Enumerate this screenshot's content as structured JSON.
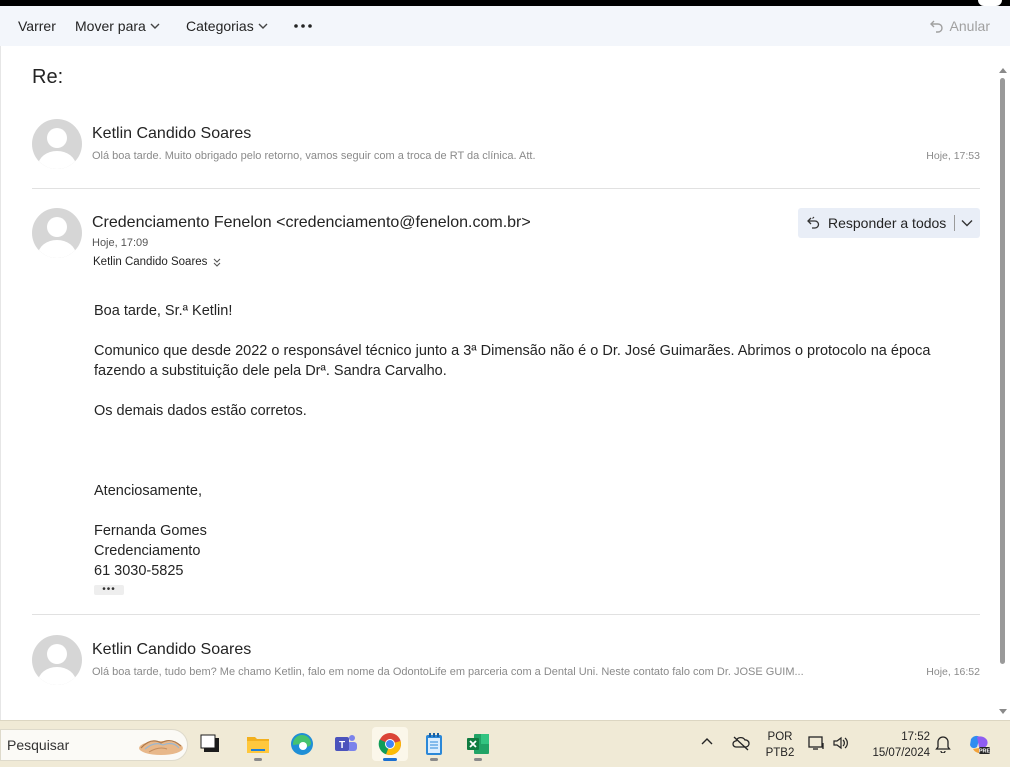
{
  "toolbar": {
    "sweep": "Varrer",
    "move_to": "Mover para",
    "categories": "Categorias",
    "undo": "Anular"
  },
  "subject": "Re:",
  "messages": [
    {
      "sender": "Ketlin Candido Soares",
      "preview": "Olá boa tarde. Muito obrigado pelo retorno, vamos seguir com a troca de RT da clínica. Att.",
      "time": "Hoje, 17:53"
    },
    {
      "sender": "Credenciamento Fenelon <credenciamento@fenelon.com.br>",
      "time": "Hoje, 17:09",
      "to": "Ketlin Candido Soares",
      "reply_all": "Responder a todos",
      "body": {
        "greeting": "Boa tarde, Sr.ª Ketlin!",
        "para1_line1": "Comunico que desde 2022 o responsável técnico junto a 3ª Dimensão não é o Dr. José Guimarães. Abrimos o protocolo na época",
        "para1_line2": "fazendo a substituição dele pela Drª. Sandra Carvalho.",
        "para2": "Os demais dados estão corretos.",
        "closing": "Atenciosamente,",
        "sig_name": "Fernanda Gomes",
        "sig_dept": "Credenciamento",
        "sig_phone": "61 3030-5825"
      }
    },
    {
      "sender": "Ketlin Candido Soares",
      "preview": "Olá boa tarde, tudo bem? Me chamo Ketlin, falo em nome da OdontoLife em parceria com a Dental Uni. Neste contato falo com Dr. JOSE GUIM...",
      "time": "Hoje, 16:52"
    }
  ],
  "taskbar": {
    "search_placeholder": "Pesquisar",
    "lang_top": "POR",
    "lang_bottom": "PTB2",
    "time": "17:52",
    "date": "15/07/2024"
  }
}
